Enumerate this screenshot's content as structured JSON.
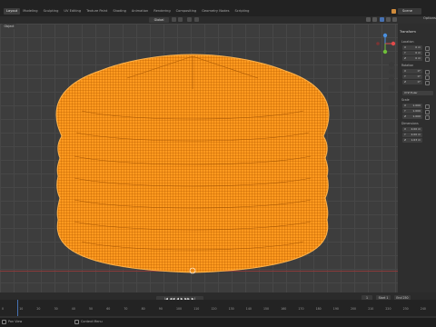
{
  "workspace_tabs": [
    "Layout",
    "Modeling",
    "Sculpting",
    "UV Editing",
    "Texture Paint",
    "Shading",
    "Animation",
    "Rendering",
    "Compositing",
    "Geometry Nodes",
    "Scripting"
  ],
  "active_tab_index": 0,
  "scene_name": "Scene",
  "options_label": "Options",
  "header": {
    "mode_label": "Object",
    "orientation_label": "Global"
  },
  "npanel": {
    "section_title": "Transform",
    "location_label": "Location",
    "location": [
      {
        "axis": "X",
        "value": "0 m"
      },
      {
        "axis": "Y",
        "value": "0 m"
      },
      {
        "axis": "Z",
        "value": "0 m"
      }
    ],
    "rotation_label": "Rotation",
    "rotation": [
      {
        "axis": "X",
        "value": "0°"
      },
      {
        "axis": "Y",
        "value": "0°"
      },
      {
        "axis": "Z",
        "value": "0°"
      }
    ],
    "rotation_mode": "XYZ Euler",
    "scale_label": "Scale",
    "scale": [
      {
        "axis": "X",
        "value": "1.000"
      },
      {
        "axis": "Y",
        "value": "1.000"
      },
      {
        "axis": "Z",
        "value": "1.000"
      }
    ],
    "dimensions_label": "Dimensions",
    "dimensions": [
      {
        "axis": "X",
        "value": "2.00 m"
      },
      {
        "axis": "Y",
        "value": "2.00 m"
      },
      {
        "axis": "Z",
        "value": "1.63 m"
      }
    ]
  },
  "timeline": {
    "frame_numbers": [
      "0",
      "10",
      "20",
      "30",
      "40",
      "50",
      "60",
      "70",
      "80",
      "90",
      "100",
      "110",
      "120",
      "130",
      "140",
      "150",
      "160",
      "170",
      "180",
      "190",
      "200",
      "210",
      "220",
      "230",
      "240"
    ],
    "current_frame": "1",
    "start_label": "Start",
    "start_value": "1",
    "end_label": "End",
    "end_value": "250",
    "playback_controls": "|◀ ◀◀ ◀ ▶ ▶▶ ▶|"
  },
  "statusbar": {
    "items": [
      "Pan View",
      "Context Menu"
    ]
  },
  "colors": {
    "object_orange": "#ff9a1f",
    "wire_orange": "#b85e00",
    "accent_blue": "#4772b3",
    "axis_red": "#8a3a3a"
  },
  "icons": [
    "scene-icon",
    "gizmo-icon",
    "hand-icon",
    "zoom-icon",
    "camera-icon",
    "grid-icon",
    "mouse-icon"
  ]
}
